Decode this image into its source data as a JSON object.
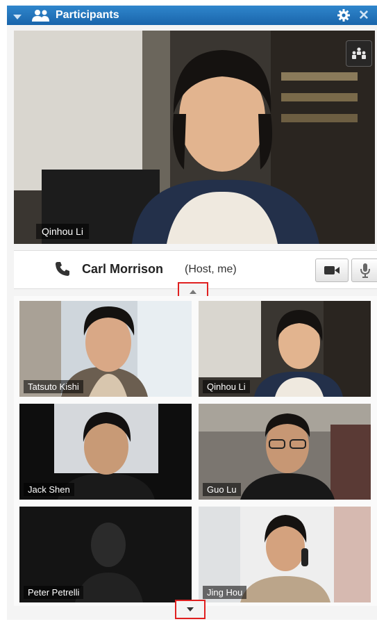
{
  "header": {
    "title": "Participants",
    "icons": [
      "chevron-down-icon",
      "participants-icon",
      "gear-icon",
      "close-icon"
    ],
    "close_glyph": "✕"
  },
  "active_speaker": {
    "name": "Qinhou Li"
  },
  "host": {
    "name": "Carl Morrison",
    "role": "(Host, me)"
  },
  "grid": {
    "participants": [
      {
        "name": "Tatsuto Kishi"
      },
      {
        "name": "Qinhou Li"
      },
      {
        "name": "Jack Shen"
      },
      {
        "name": "Guo Lu"
      },
      {
        "name": "Peter Petrelli"
      },
      {
        "name": "Jing Hou"
      }
    ]
  },
  "colors": {
    "titlebar": "#1f6fb5",
    "highlight": "#e02020"
  }
}
